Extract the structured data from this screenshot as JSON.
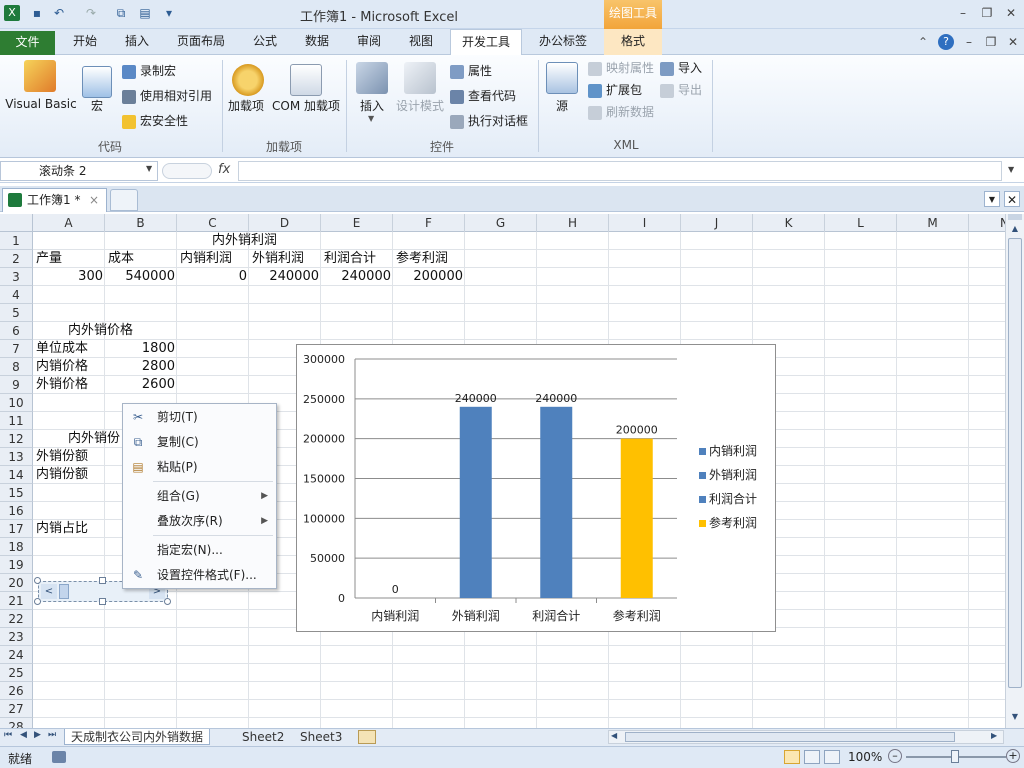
{
  "window": {
    "title": "工作簿1 - Microsoft Excel",
    "contextual_tab_group": "绘图工具"
  },
  "ribbon_tabs": [
    "文件",
    "开始",
    "插入",
    "页面布局",
    "公式",
    "数据",
    "审阅",
    "视图",
    "开发工具",
    "办公标签",
    "格式"
  ],
  "active_tab": "开发工具",
  "ribbon": {
    "code": {
      "label": "代码",
      "visual_basic": "Visual Basic",
      "macros": "宏",
      "record_macro": "录制宏",
      "relative_ref": "使用相对引用",
      "macro_security": "宏安全性"
    },
    "addins": {
      "label": "加载项",
      "addins": "加载项",
      "com_addins": "COM 加载项"
    },
    "controls": {
      "label": "控件",
      "insert": "插入",
      "design_mode": "设计模式",
      "properties": "属性",
      "view_code": "查看代码",
      "run_dialog": "执行对话框"
    },
    "xml": {
      "label": "XML",
      "source": "源",
      "map_properties": "映射属性",
      "expansion_packs": "扩展包",
      "refresh_data": "刷新数据",
      "import": "导入",
      "export": "导出"
    }
  },
  "formula_bar": {
    "name_box": "滚动条 2",
    "fx": "fx",
    "formula": ""
  },
  "doc_tab": {
    "label": "工作簿1 *"
  },
  "columns": [
    "A",
    "B",
    "C",
    "D",
    "E",
    "F",
    "G",
    "H",
    "I",
    "J",
    "K",
    "L",
    "M",
    "N"
  ],
  "rows": [
    "1",
    "2",
    "3",
    "4",
    "5",
    "6",
    "7",
    "8",
    "9",
    "10",
    "11",
    "12",
    "13",
    "14",
    "15",
    "16",
    "17",
    "18",
    "19",
    "20",
    "21",
    "22",
    "23",
    "24",
    "25",
    "26",
    "27",
    "28"
  ],
  "cells": {
    "c1": "内外销利润",
    "a2": "产量",
    "b2": "成本",
    "c2": "内销利润",
    "d2": "外销利润",
    "e2": "利润合计",
    "f2": "参考利润",
    "a3": "300",
    "b3": "540000",
    "c3": "0",
    "d3": "240000",
    "e3": "240000",
    "f3": "200000",
    "a6": "内外销价格",
    "a7": "单位成本",
    "b7": "1800",
    "a8": "内销价格",
    "b8": "2800",
    "a9": "外销价格",
    "b9": "2600",
    "a12": "内外销份",
    "a13": "外销份额",
    "a14": "内销份额",
    "a17": "内销占比"
  },
  "context_menu": {
    "cut": "剪切(T)",
    "copy": "复制(C)",
    "paste": "粘贴(P)",
    "group": "组合(G)",
    "order": "叠放次序(R)",
    "assign_macro": "指定宏(N)...",
    "format_control": "设置控件格式(F)..."
  },
  "chart_data": {
    "type": "bar",
    "categories": [
      "内销利润",
      "外销利润",
      "利润合计",
      "参考利润"
    ],
    "values": [
      0,
      240000,
      240000,
      200000
    ],
    "legend": [
      "内销利润",
      "外销利润",
      "利润合计",
      "参考利润"
    ],
    "legend_position": "right",
    "colors": [
      "#4f81bd",
      "#4f81bd",
      "#4f81bd",
      "#ffc000"
    ],
    "ylim": [
      0,
      300000
    ],
    "yticks": [
      "0",
      "50000",
      "100000",
      "150000",
      "200000",
      "250000",
      "300000"
    ],
    "data_labels": [
      "0",
      "240000",
      "240000",
      "200000"
    ],
    "grid": true
  },
  "sheets": [
    "天成制衣公司内外销数据",
    "Sheet2",
    "Sheet3"
  ],
  "status": {
    "ready": "就绪",
    "zoom": "100%"
  }
}
